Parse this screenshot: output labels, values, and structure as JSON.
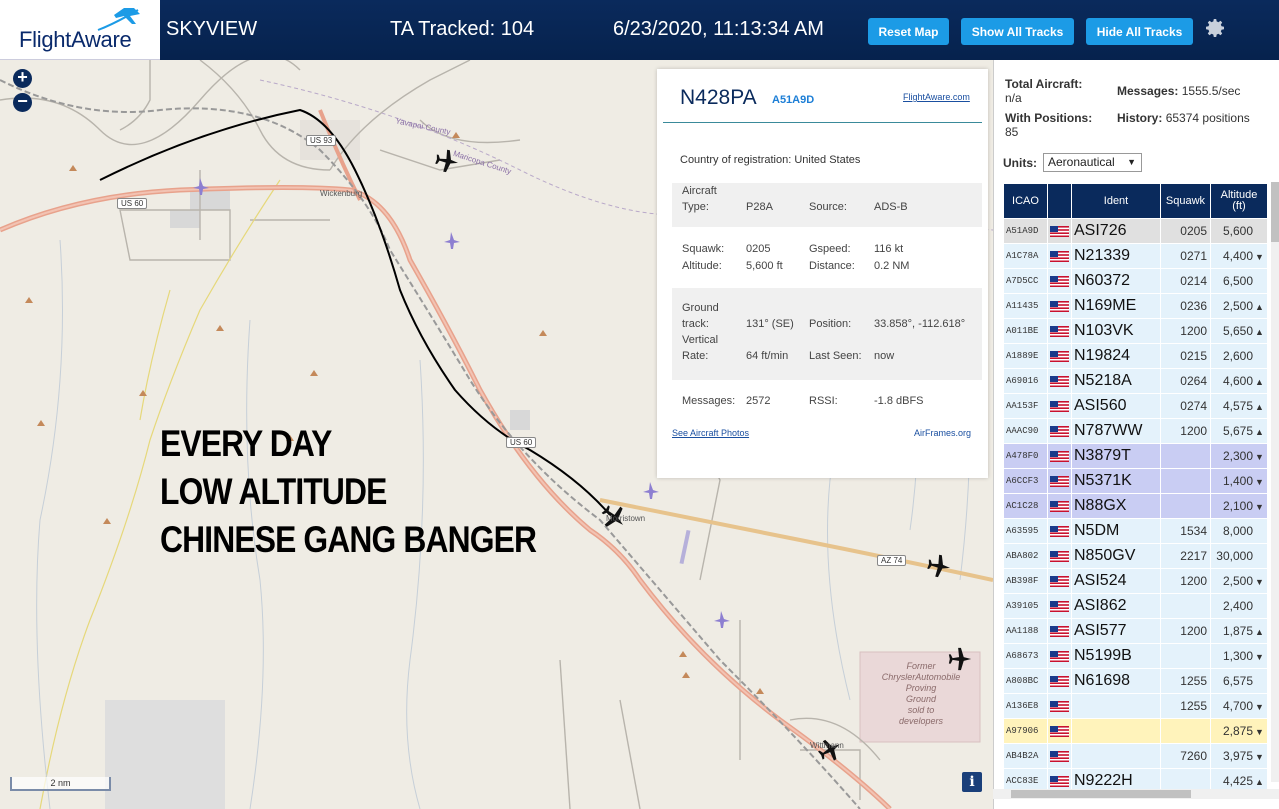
{
  "header": {
    "logo_text": "FlightAware",
    "title": "SKYVIEW",
    "tracked": "TA Tracked: 104",
    "datetime": "6/23/2020, 11:13:34 AM",
    "buttons": {
      "reset": "Reset Map",
      "show_all": "Show All Tracks",
      "hide_all": "Hide All Tracks"
    },
    "colors": {
      "bar": "#0a2a5c",
      "button": "#1c9be6"
    }
  },
  "map": {
    "zoom_in": "+",
    "zoom_out": "−",
    "overlay_lines": [
      "EVERY DAY",
      "LOW ALTITUDE",
      "CHINESE GANG BANGER"
    ],
    "scale": "2 nm",
    "info": "i",
    "labels": {
      "yavapai": "Yavapai County",
      "maricopa": "Maricopa County",
      "wickenburg": "Wickenburg",
      "morristown": "Morristown",
      "wittmann": "Wittmann",
      "chrysler": [
        "Former",
        "ChryslerAutomobile",
        "Proving",
        "Ground",
        "sold to",
        "developers"
      ]
    },
    "shields": {
      "us93": "US 93",
      "us60_west": "US 60",
      "us60_mid": "US 60",
      "az74": "AZ 74"
    }
  },
  "popup": {
    "ident": "N428PA",
    "icao": "A51A9D",
    "link": "FlightAware.com",
    "country_label": "Country of registration:",
    "country": "United States",
    "type_label_1": "Aircraft",
    "type_label_2": "Type:",
    "type": "P28A",
    "source_label": "Source:",
    "source": "ADS-B",
    "squawk_label": "Squawk:",
    "squawk": "0205",
    "gspeed_label": "Gspeed:",
    "gspeed": "116 kt",
    "altitude_label": "Altitude:",
    "altitude": "5,600 ft",
    "distance_label": "Distance:",
    "distance": "0.2 NM",
    "track_label_1": "Ground",
    "track_label_2": "track:",
    "track": "131° (SE)",
    "position_label": "Position:",
    "position": "33.858°, -112.618°",
    "vrate_label_1": "Vertical",
    "vrate_label_2": "Rate:",
    "vrate": "64 ft/min",
    "lastseen_label": "Last Seen:",
    "lastseen": "now",
    "messages_label": "Messages:",
    "messages": "2572",
    "rssi_label": "RSSI:",
    "rssi": "-1.8 dBFS",
    "photos_link": "See Aircraft Photos",
    "airframes_link": "AirFrames.org"
  },
  "sidebar": {
    "total_label": "Total Aircraft:",
    "total": "n/a",
    "messages_label": "Messages:",
    "messages": "1555.5/sec",
    "positions_label": "With Positions:",
    "positions": "85",
    "history_label": "History:",
    "history": "65374 positions",
    "units_label": "Units:",
    "units": "Aeronautical",
    "columns": {
      "icao": "ICAO",
      "ident": "Ident",
      "squawk": "Squawk",
      "altitude": "Altitude (ft)"
    },
    "row_colors": {
      "selected": "#e0e0e0",
      "normal": "#e4f2fb",
      "highlight": "#c9cdf3",
      "yellow": "#fff3bb"
    },
    "rows": [
      {
        "icao": "A51A9D",
        "ident": "ASI726",
        "squawk": "0205",
        "alt": "5,600",
        "trend": "",
        "style": "selected"
      },
      {
        "icao": "A1C78A",
        "ident": "N21339",
        "squawk": "0271",
        "alt": "4,400",
        "trend": "▼",
        "style": "normal"
      },
      {
        "icao": "A7D5CC",
        "ident": "N60372",
        "squawk": "0214",
        "alt": "6,500",
        "trend": "",
        "style": "normal"
      },
      {
        "icao": "A11435",
        "ident": "N169ME",
        "squawk": "0236",
        "alt": "2,500",
        "trend": "▲",
        "style": "normal"
      },
      {
        "icao": "A011BE",
        "ident": "N103VK",
        "squawk": "1200",
        "alt": "5,650",
        "trend": "▲",
        "style": "normal"
      },
      {
        "icao": "A1889E",
        "ident": "N19824",
        "squawk": "0215",
        "alt": "2,600",
        "trend": "",
        "style": "normal"
      },
      {
        "icao": "A69016",
        "ident": "N5218A",
        "squawk": "0264",
        "alt": "4,600",
        "trend": "▲",
        "style": "normal"
      },
      {
        "icao": "AA153F",
        "ident": "ASI560",
        "squawk": "0274",
        "alt": "4,575",
        "trend": "▲",
        "style": "normal"
      },
      {
        "icao": "AAAC90",
        "ident": "N787WW",
        "squawk": "1200",
        "alt": "5,675",
        "trend": "▲",
        "style": "normal"
      },
      {
        "icao": "A478F0",
        "ident": "N3879T",
        "squawk": "",
        "alt": "2,300",
        "trend": "▼",
        "style": "highlight"
      },
      {
        "icao": "A6CCF3",
        "ident": "N5371K",
        "squawk": "",
        "alt": "1,400",
        "trend": "▼",
        "style": "highlight"
      },
      {
        "icao": "AC1C28",
        "ident": "N88GX",
        "squawk": "",
        "alt": "2,100",
        "trend": "▼",
        "style": "highlight"
      },
      {
        "icao": "A63595",
        "ident": "N5DM",
        "squawk": "1534",
        "alt": "8,000",
        "trend": "",
        "style": "normal"
      },
      {
        "icao": "ABA802",
        "ident": "N850GV",
        "squawk": "2217",
        "alt": "30,000",
        "trend": "",
        "style": "normal"
      },
      {
        "icao": "AB398F",
        "ident": "ASI524",
        "squawk": "1200",
        "alt": "2,500",
        "trend": "▼",
        "style": "normal"
      },
      {
        "icao": "A39105",
        "ident": "ASI862",
        "squawk": "",
        "alt": "2,400",
        "trend": "",
        "style": "normal"
      },
      {
        "icao": "AA1188",
        "ident": "ASI577",
        "squawk": "1200",
        "alt": "1,875",
        "trend": "▲",
        "style": "normal"
      },
      {
        "icao": "A68673",
        "ident": "N5199B",
        "squawk": "",
        "alt": "1,300",
        "trend": "▼",
        "style": "normal"
      },
      {
        "icao": "A808BC",
        "ident": "N61698",
        "squawk": "1255",
        "alt": "6,575",
        "trend": "",
        "style": "normal"
      },
      {
        "icao": "A136E8",
        "ident": "",
        "squawk": "1255",
        "alt": "4,700",
        "trend": "▼",
        "style": "normal"
      },
      {
        "icao": "A97906",
        "ident": "",
        "squawk": "",
        "alt": "2,875",
        "trend": "▼",
        "style": "yellow"
      },
      {
        "icao": "AB4B2A",
        "ident": "",
        "squawk": "7260",
        "alt": "3,975",
        "trend": "▼",
        "style": "normal"
      },
      {
        "icao": "ACC83E",
        "ident": "N9222H",
        "squawk": "",
        "alt": "4,425",
        "trend": "▲",
        "style": "normal"
      }
    ]
  }
}
